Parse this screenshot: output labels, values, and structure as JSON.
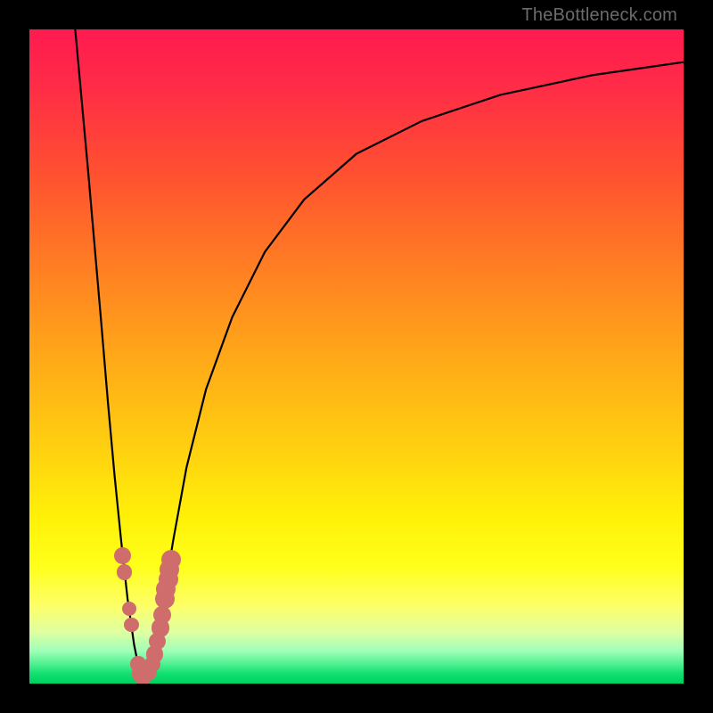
{
  "watermark": "TheBottleneck.com",
  "chart_data": {
    "type": "line",
    "title": "",
    "xlabel": "",
    "ylabel": "",
    "xlim": [
      0,
      100
    ],
    "ylim": [
      0,
      100
    ],
    "grid": false,
    "legend": false,
    "note": "Bottleneck curve: sharp V-shaped dip near x≈17 where bottleneck ≈ 0 (green band), rising steeply to red at both sides. No axis ticks or labels visible.",
    "series": [
      {
        "name": "bottleneck-curve",
        "x": [
          7,
          9,
          11,
          12,
          13,
          14,
          15,
          16,
          17,
          18,
          19,
          20,
          21,
          22,
          24,
          27,
          31,
          36,
          42,
          50,
          60,
          72,
          86,
          100
        ],
        "y": [
          100,
          78,
          55,
          43,
          32,
          22,
          13,
          6,
          1,
          1,
          5,
          10,
          16,
          22,
          33,
          45,
          56,
          66,
          74,
          81,
          86,
          90,
          93,
          95
        ]
      }
    ],
    "markers": {
      "name": "highlight-dots",
      "color": "#cf6d6d",
      "points": [
        {
          "x": 14.3,
          "y": 19.5,
          "r": 1.3
        },
        {
          "x": 14.5,
          "y": 17.0,
          "r": 1.2
        },
        {
          "x": 15.3,
          "y": 11.5,
          "r": 1.1
        },
        {
          "x": 15.6,
          "y": 9.0,
          "r": 1.1
        },
        {
          "x": 16.6,
          "y": 3.0,
          "r": 1.2
        },
        {
          "x": 17.0,
          "y": 1.5,
          "r": 1.3
        },
        {
          "x": 17.4,
          "y": 1.0,
          "r": 1.3
        },
        {
          "x": 20.7,
          "y": 13.0,
          "r": 1.5
        },
        {
          "x": 20.9,
          "y": 14.5,
          "r": 1.5
        },
        {
          "x": 21.2,
          "y": 16.0,
          "r": 1.5
        },
        {
          "x": 21.4,
          "y": 17.5,
          "r": 1.5
        },
        {
          "x": 21.7,
          "y": 19.0,
          "r": 1.5
        },
        {
          "x": 20.3,
          "y": 10.5,
          "r": 1.4
        },
        {
          "x": 20.0,
          "y": 8.5,
          "r": 1.4
        },
        {
          "x": 19.6,
          "y": 6.5,
          "r": 1.3
        },
        {
          "x": 19.2,
          "y": 4.5,
          "r": 1.3
        },
        {
          "x": 18.8,
          "y": 3.0,
          "r": 1.2
        },
        {
          "x": 18.3,
          "y": 1.8,
          "r": 1.2
        }
      ]
    },
    "gradient_stops": [
      {
        "pos": 0.0,
        "color": "#ff1a4f"
      },
      {
        "pos": 0.5,
        "color": "#ffa818"
      },
      {
        "pos": 0.82,
        "color": "#ffff1a"
      },
      {
        "pos": 1.0,
        "color": "#00d060"
      }
    ]
  }
}
